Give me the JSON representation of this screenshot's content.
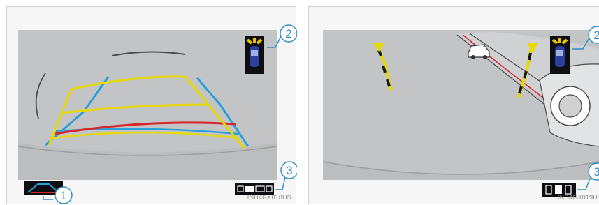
{
  "left_panel": {
    "image_code": "IND4GX018US",
    "callouts": [
      "1",
      "2",
      "3"
    ]
  },
  "right_panel": {
    "image_code": "IND4GX019U",
    "callouts": [
      "2",
      "3"
    ]
  },
  "colors": {
    "callout": "#2e8ec4",
    "screen": "#c2c4c6",
    "guide_yellow": "#e8d900",
    "guide_blue": "#2a9fd8",
    "guide_red": "#d8262a",
    "car_blue": "#2b3f9e",
    "sensor_yellow": "#e6c400"
  },
  "icons": [
    "guideline-switch-icon",
    "sensor-display-icon",
    "parking-sensor-bar-icon"
  ]
}
